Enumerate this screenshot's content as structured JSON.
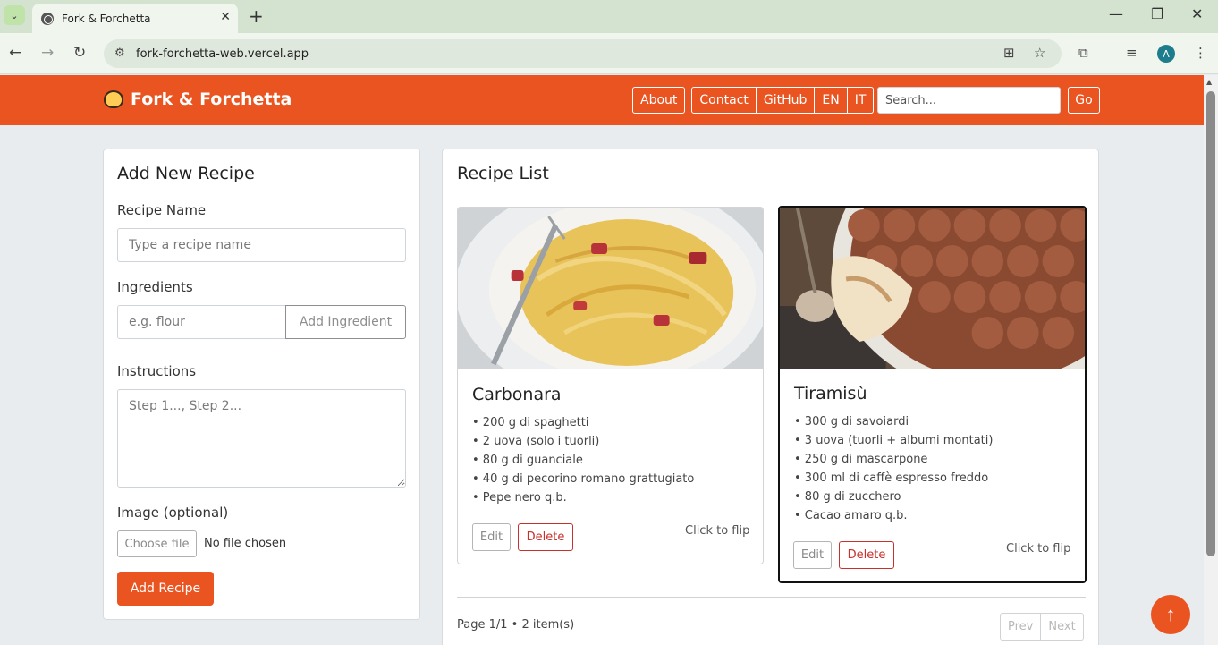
{
  "browser": {
    "tab_title": "Fork & Forchetta",
    "url": "fork-forchetta-web.vercel.app",
    "avatar_letter": "A"
  },
  "navbar": {
    "brand": "Fork & Forchetta",
    "links": [
      "About",
      "Contact",
      "GitHub",
      "EN",
      "IT"
    ],
    "search_placeholder": "Search...",
    "go_label": "Go",
    "color": "#e95420"
  },
  "form": {
    "title": "Add New Recipe",
    "name_label": "Recipe Name",
    "name_placeholder": "Type a recipe name",
    "ingredients_label": "Ingredients",
    "ingredient_placeholder": "e.g. flour",
    "add_ingredient_label": "Add Ingredient",
    "instructions_label": "Instructions",
    "instructions_placeholder": "Step 1..., Step 2...",
    "image_label": "Image (optional)",
    "choose_file_label": "Choose file",
    "file_status": "No file chosen",
    "submit_label": "Add Recipe"
  },
  "list": {
    "title": "Recipe List",
    "recipes": [
      {
        "name": "Carbonara",
        "ingredients": [
          "• 200 g di spaghetti",
          "• 2 uova (solo i tuorli)",
          "• 80 g di guanciale",
          "• 40 g di pecorino romano grattugiato",
          "• Pepe nero q.b."
        ],
        "edit_label": "Edit",
        "delete_label": "Delete",
        "flip_hint": "Click to flip"
      },
      {
        "name": "Tiramisù",
        "ingredients": [
          "• 300 g di savoiardi",
          "• 3 uova (tuorli + albumi montati)",
          "• 250 g di mascarpone",
          "• 300 ml di caffè espresso freddo",
          "• 80 g di zucchero",
          "• Cacao amaro q.b."
        ],
        "edit_label": "Edit",
        "delete_label": "Delete",
        "flip_hint": "Click to flip"
      }
    ],
    "page_info": "Page 1/1 • 2 item(s)",
    "prev_label": "Prev",
    "next_label": "Next"
  },
  "scroll_top_icon": "arrow-up-icon"
}
